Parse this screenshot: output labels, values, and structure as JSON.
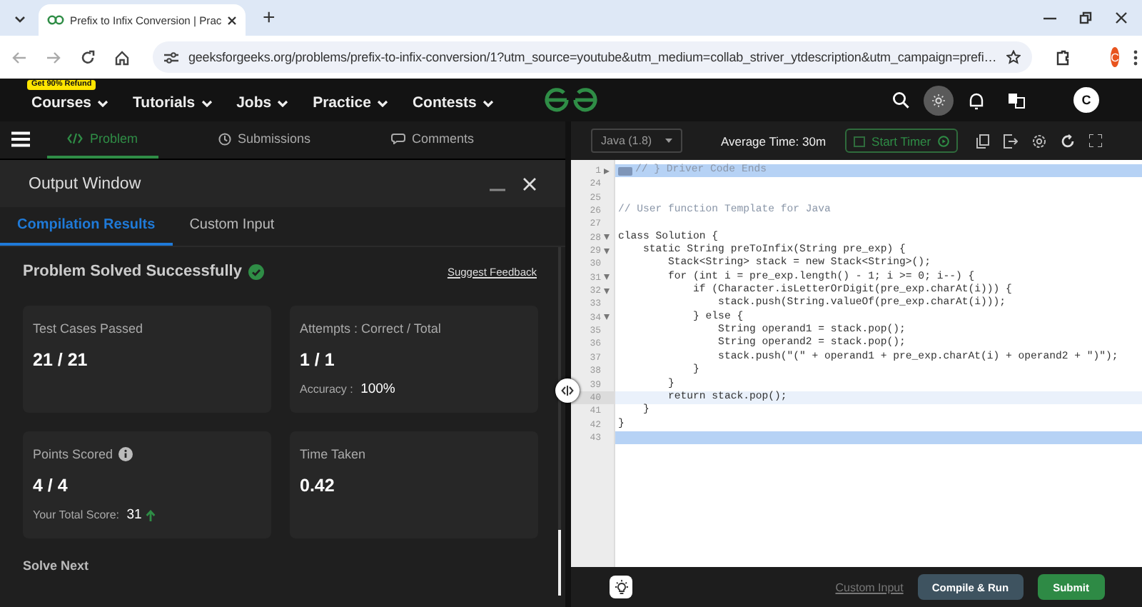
{
  "browser": {
    "tab_title": "Prefix to Infix Conversion | Prac",
    "new_tab": "+",
    "url": "geeksforgeeks.org/problems/prefix-to-infix-conversion/1?utm_source=youtube&utm_medium=collab_striver_ytdescription&utm_campaign=prefi…",
    "profile_initial": "C"
  },
  "site_nav": {
    "badge": "Get 90% Refund",
    "menus": [
      "Courses",
      "Tutorials",
      "Jobs",
      "Practice",
      "Contests"
    ],
    "profile_initial": "C"
  },
  "problem_tabs": [
    {
      "label": "Problem",
      "selected": true
    },
    {
      "label": "Submissions",
      "selected": false
    },
    {
      "label": "Comments",
      "selected": false
    }
  ],
  "output_window": {
    "title": "Output Window",
    "tabs": [
      {
        "label": "Compilation Results",
        "selected": true
      },
      {
        "label": "Custom Input",
        "selected": false
      }
    ],
    "status": "Problem Solved Successfully",
    "feedback_link": "Suggest Feedback",
    "cards": [
      {
        "label": "Test Cases Passed",
        "value": "21 / 21"
      },
      {
        "label": "Attempts : Correct / Total",
        "value": "1 / 1",
        "note_label": "Accuracy : ",
        "note_value": "100%"
      },
      {
        "label": "Points Scored",
        "value": "4 / 4",
        "note_label": "Your Total Score: ",
        "note_value": "31",
        "info_icon": true,
        "trend_up": true
      },
      {
        "label": "Time Taken",
        "value": "0.42"
      }
    ],
    "solve_next": "Solve Next"
  },
  "editor": {
    "language": "Java (1.8)",
    "average_time": "Average Time: 30m",
    "start_timer": "Start Timer",
    "lines": [
      {
        "number": "1",
        "text": "// } Driver Code Ends",
        "kind": "comment",
        "foldable": true,
        "collapsed": true,
        "highlighted": true
      },
      {
        "number": "24",
        "kind": "code"
      },
      {
        "number": "25",
        "kind": "code"
      },
      {
        "number": "26",
        "text": "// User function Template for Java",
        "kind": "comment"
      },
      {
        "number": "27",
        "kind": "code"
      },
      {
        "number": "28",
        "text": "class Solution {",
        "kind": "code",
        "foldable": true
      },
      {
        "number": "29",
        "text": "    static String preToInfix(String pre_exp) {",
        "kind": "code",
        "foldable": true
      },
      {
        "number": "30",
        "text": "        Stack<String> stack = new Stack<String>();",
        "kind": "code"
      },
      {
        "number": "31",
        "text": "        for (int i = pre_exp.length() - 1; i >= 0; i--) {",
        "kind": "code",
        "foldable": true
      },
      {
        "number": "32",
        "text": "            if (Character.isLetterOrDigit(pre_exp.charAt(i))) {",
        "kind": "code",
        "foldable": true
      },
      {
        "number": "33",
        "text": "                stack.push(String.valueOf(pre_exp.charAt(i)));",
        "kind": "code"
      },
      {
        "number": "34",
        "text": "            } else {",
        "kind": "code",
        "foldable": true
      },
      {
        "number": "35",
        "text": "                String operand1 = stack.pop();",
        "kind": "code"
      },
      {
        "number": "36",
        "text": "                String operand2 = stack.pop();",
        "kind": "code"
      },
      {
        "number": "37",
        "text": "                stack.push(\"(\" + operand1 + pre_exp.charAt(i) + operand2 + \")\");",
        "kind": "code"
      },
      {
        "number": "38",
        "text": "            }",
        "kind": "code"
      },
      {
        "number": "39",
        "text": "        }",
        "kind": "code"
      },
      {
        "number": "40",
        "text": "        return stack.pop();",
        "kind": "code",
        "active": true
      },
      {
        "number": "41",
        "text": "    }",
        "kind": "code"
      },
      {
        "number": "42",
        "text": "}",
        "kind": "code"
      },
      {
        "number": "43",
        "kind": "code",
        "highlighted": true
      }
    ]
  },
  "footer": {
    "custom_input": "Custom Input",
    "compile": "Compile & Run",
    "submit": "Submit"
  }
}
